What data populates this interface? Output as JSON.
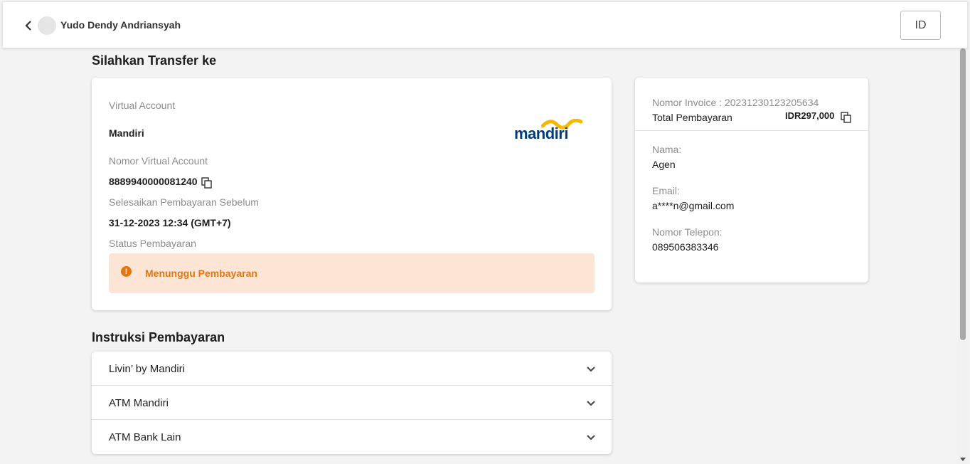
{
  "header": {
    "user_name": "Yudo Dendy Andriansyah",
    "language_button": "ID"
  },
  "transfer": {
    "section_title": "Silahkan Transfer ke",
    "payment_method_label": "Virtual Account",
    "bank_name": "Mandiri",
    "bank_logo_text": "mandiri",
    "va_number_label": "Nomor Virtual Account",
    "va_number": "8889940000081240",
    "deadline_label": "Selesaikan Pembayaran Sebelum",
    "deadline_value": "31-12-2023 12:34 (GMT+7)",
    "status_label": "Status Pembayaran",
    "status_value": "Menunggu Pembayaran",
    "status_icon": "!"
  },
  "invoice": {
    "invoice_text": "Nomor Invoice : 20231230123205634",
    "total_label": "Total Pembayaran",
    "total_value": "IDR297,000",
    "name_label": "Nama:",
    "name_value": "Agen",
    "email_label": "Email:",
    "email_value": "a****n@gmail.com",
    "phone_label": "Nomor Telepon:",
    "phone_value": "089506383346"
  },
  "instructions": {
    "section_title": "Instruksi Pembayaran",
    "items": [
      {
        "label": "Livin’ by Mandiri"
      },
      {
        "label": "ATM Mandiri"
      },
      {
        "label": "ATM Bank Lain"
      }
    ]
  },
  "colors": {
    "status_accent": "#e07712",
    "status_background": "#fde5d6",
    "brand_blue": "#003d79",
    "brand_yellow": "#f5b800"
  }
}
